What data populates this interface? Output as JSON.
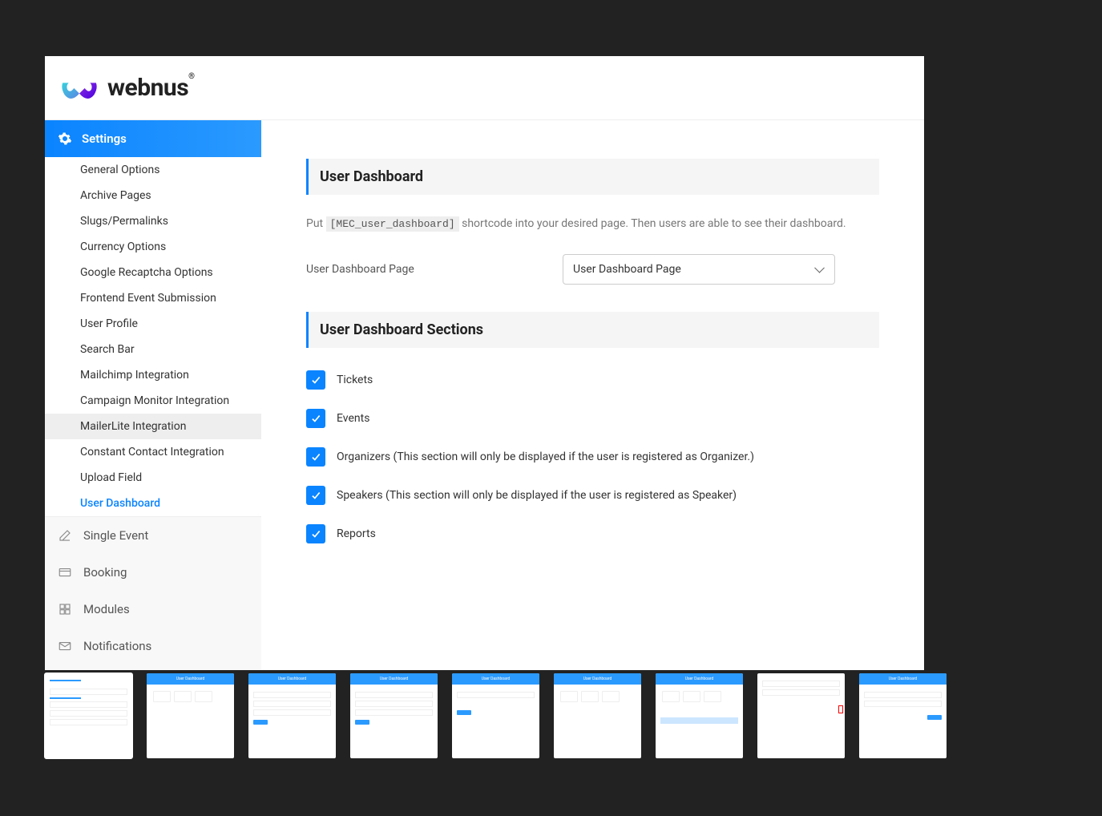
{
  "brand": {
    "name": "webnus"
  },
  "sidebar": {
    "active_head": "Settings",
    "sub": [
      "General Options",
      "Archive Pages",
      "Slugs/Permalinks",
      "Currency Options",
      "Google Recaptcha Options",
      "Frontend Event Submission",
      "User Profile",
      "Search Bar",
      "Mailchimp Integration",
      "Campaign Monitor Integration",
      "MailerLite Integration",
      "Constant Contact Integration",
      "Upload Field",
      "User Dashboard"
    ],
    "sub_highlight_index": 10,
    "sub_active_index": 13,
    "main": [
      "Single Event",
      "Booking",
      "Modules",
      "Notifications"
    ]
  },
  "content": {
    "section1_title": "User Dashboard",
    "hint_prefix": "Put ",
    "hint_code": "[MEC_user_dashboard]",
    "hint_suffix": " shortcode into your desired page. Then users are able to see their dashboard.",
    "row_label": "User Dashboard Page",
    "select_value": "User Dashboard Page",
    "section2_title": "User Dashboard Sections",
    "checks": [
      {
        "label": "Tickets",
        "checked": true
      },
      {
        "label": "Events",
        "checked": true
      },
      {
        "label": "Organizers (This section will only be displayed if the user is registered as Organizer.)",
        "checked": true
      },
      {
        "label": "Speakers (This section will only be displayed if the user is registered as Speaker)",
        "checked": true
      },
      {
        "label": "Reports",
        "checked": true
      }
    ]
  },
  "thumbs": {
    "bar_label": "User Dashboard",
    "count": 9
  }
}
